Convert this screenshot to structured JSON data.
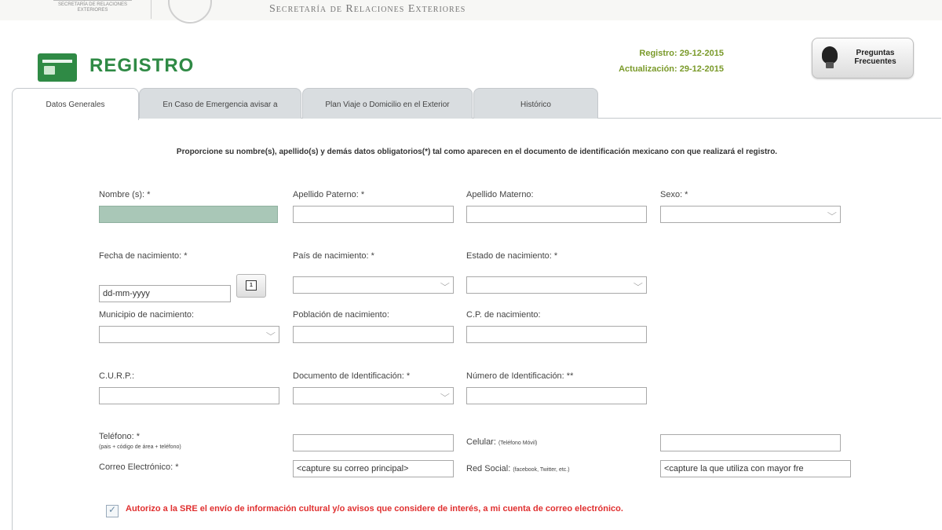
{
  "header": {
    "logo_text": "SECRETARÍA DE RELACIONES EXTERIORES",
    "secretaria": "Secretaría de Relaciones Exteriores"
  },
  "registro": {
    "title": "REGISTRO",
    "registro_date": "Registro: 29-12-2015",
    "actualizacion_date": "Actualización: 29-12-2015"
  },
  "faq_button": {
    "label": "Preguntas Frecuentes"
  },
  "tabs": [
    {
      "label": "Datos Generales"
    },
    {
      "label": "En Caso de Emergencia avisar a"
    },
    {
      "label": "Plan Viaje o Domicilio en el Exterior"
    },
    {
      "label": "Histórico"
    }
  ],
  "instructions": "Proporcione su nombre(s), apellido(s) y demás datos obligatorios(*) tal como aparecen en el documento de identificación mexicano con que realizará el registro.",
  "form": {
    "nombre": {
      "label": "Nombre (s): *",
      "value": ""
    },
    "apellido_paterno": {
      "label": "Apellido Paterno: *",
      "value": ""
    },
    "apellido_materno": {
      "label": "Apellido Materno:",
      "value": ""
    },
    "sexo": {
      "label": "Sexo: *"
    },
    "fecha_nacimiento": {
      "label": "Fecha de nacimiento: *",
      "value": "dd-mm-yyyy"
    },
    "pais_nacimiento": {
      "label": "País de nacimiento: *"
    },
    "estado_nacimiento": {
      "label": "Estado de nacimiento: *"
    },
    "municipio_nacimiento": {
      "label": "Municipio de nacimiento:"
    },
    "poblacion_nacimiento": {
      "label": "Población de nacimiento:"
    },
    "cp_nacimiento": {
      "label": "C.P. de nacimiento:"
    },
    "curp": {
      "label": "C.U.R.P.:"
    },
    "documento_identificacion": {
      "label": "Documento de Identificación: *"
    },
    "numero_identificacion": {
      "label": "Número de Identificación: **"
    },
    "telefono": {
      "label": "Teléfono: *",
      "hint": "(pais + código de área + teléfono)"
    },
    "celular": {
      "label": "Celular:",
      "hint": "(Teléfono Móvil)"
    },
    "correo": {
      "label": "Correo Electrónico: *",
      "value": "<capture su correo principal>"
    },
    "red_social": {
      "label": "Red Social:",
      "hint": "(facebook, Twitter, etc.)",
      "value": "<capture la que utiliza con mayor fre"
    },
    "consent": "Autorizo a la SRE el envío de información cultural y/o avisos que considere de interés, a mi cuenta de correo electrónico."
  }
}
